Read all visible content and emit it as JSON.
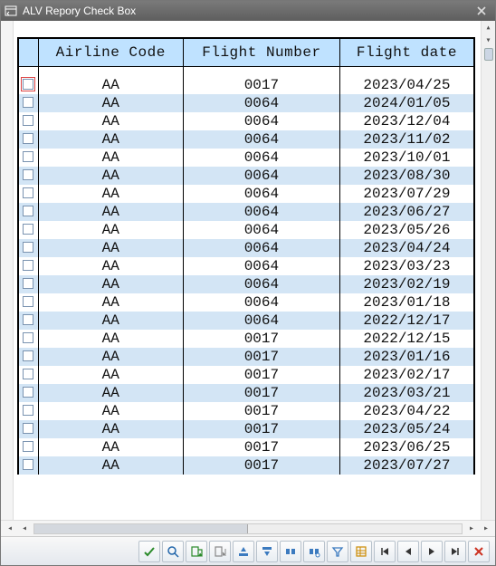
{
  "window": {
    "title": "ALV Repory Check Box"
  },
  "grid": {
    "columns": [
      "Airline Code",
      "Flight Number",
      "Flight date"
    ],
    "rows": [
      {
        "checked": false,
        "focused": true,
        "airline": "AA",
        "flight": "0017",
        "date": "2023/04/25"
      },
      {
        "checked": false,
        "focused": false,
        "airline": "AA",
        "flight": "0064",
        "date": "2024/01/05"
      },
      {
        "checked": false,
        "focused": false,
        "airline": "AA",
        "flight": "0064",
        "date": "2023/12/04"
      },
      {
        "checked": false,
        "focused": false,
        "airline": "AA",
        "flight": "0064",
        "date": "2023/11/02"
      },
      {
        "checked": false,
        "focused": false,
        "airline": "AA",
        "flight": "0064",
        "date": "2023/10/01"
      },
      {
        "checked": false,
        "focused": false,
        "airline": "AA",
        "flight": "0064",
        "date": "2023/08/30"
      },
      {
        "checked": false,
        "focused": false,
        "airline": "AA",
        "flight": "0064",
        "date": "2023/07/29"
      },
      {
        "checked": false,
        "focused": false,
        "airline": "AA",
        "flight": "0064",
        "date": "2023/06/27"
      },
      {
        "checked": false,
        "focused": false,
        "airline": "AA",
        "flight": "0064",
        "date": "2023/05/26"
      },
      {
        "checked": false,
        "focused": false,
        "airline": "AA",
        "flight": "0064",
        "date": "2023/04/24"
      },
      {
        "checked": false,
        "focused": false,
        "airline": "AA",
        "flight": "0064",
        "date": "2023/03/23"
      },
      {
        "checked": false,
        "focused": false,
        "airline": "AA",
        "flight": "0064",
        "date": "2023/02/19"
      },
      {
        "checked": false,
        "focused": false,
        "airline": "AA",
        "flight": "0064",
        "date": "2023/01/18"
      },
      {
        "checked": false,
        "focused": false,
        "airline": "AA",
        "flight": "0064",
        "date": "2022/12/17"
      },
      {
        "checked": false,
        "focused": false,
        "airline": "AA",
        "flight": "0017",
        "date": "2022/12/15"
      },
      {
        "checked": false,
        "focused": false,
        "airline": "AA",
        "flight": "0017",
        "date": "2023/01/16"
      },
      {
        "checked": false,
        "focused": false,
        "airline": "AA",
        "flight": "0017",
        "date": "2023/02/17"
      },
      {
        "checked": false,
        "focused": false,
        "airline": "AA",
        "flight": "0017",
        "date": "2023/03/21"
      },
      {
        "checked": false,
        "focused": false,
        "airline": "AA",
        "flight": "0017",
        "date": "2023/04/22"
      },
      {
        "checked": false,
        "focused": false,
        "airline": "AA",
        "flight": "0017",
        "date": "2023/05/24"
      },
      {
        "checked": false,
        "focused": false,
        "airline": "AA",
        "flight": "0017",
        "date": "2023/06/25"
      },
      {
        "checked": false,
        "focused": false,
        "airline": "AA",
        "flight": "0017",
        "date": "2023/07/27"
      }
    ]
  },
  "toolbar": {
    "buttons": [
      "check",
      "search",
      "export",
      "export-local",
      "sort-asc",
      "sort-desc",
      "find",
      "find-next",
      "filter",
      "layout",
      "nav-first",
      "nav-prev",
      "nav-next",
      "nav-last",
      "close"
    ]
  }
}
